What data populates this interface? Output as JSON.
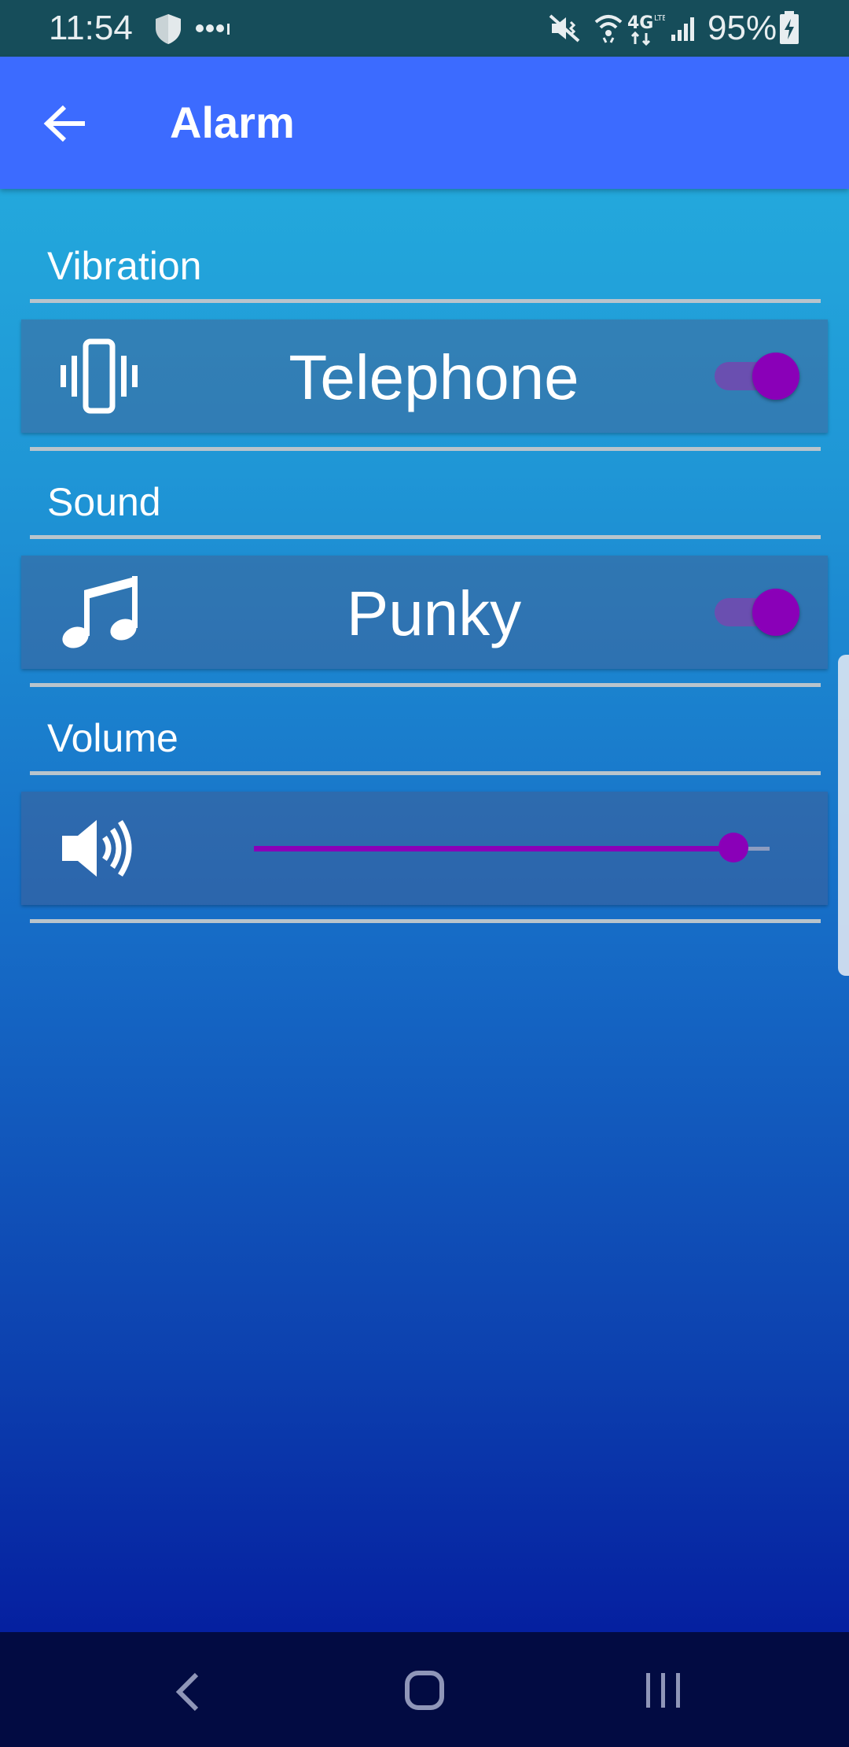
{
  "status_bar": {
    "time": "11:54",
    "battery": "95%",
    "icons": [
      "shield-icon",
      "more-dots-icon",
      "mute-vibrate-icon",
      "wifi-icon",
      "4g-lte-icon",
      "signal-icon",
      "battery-charging-icon"
    ]
  },
  "app_bar": {
    "title": "Alarm",
    "back_icon": "arrow-back-icon",
    "color": "#3c6bff"
  },
  "vibration": {
    "section_label": "Vibration",
    "item_label": "Telephone",
    "icon": "vibrate-icon",
    "enabled": true
  },
  "sound": {
    "section_label": "Sound",
    "item_label": "Punky",
    "icon": "music-note-icon",
    "enabled": true
  },
  "volume": {
    "section_label": "Volume",
    "icon": "speaker-volume-icon",
    "level": 0.93
  },
  "nav_bar": {
    "icons": [
      "nav-back-icon",
      "nav-home-icon",
      "nav-recents-icon"
    ]
  },
  "colors": {
    "accent": "#8a00b8",
    "status_bar": "#164d5a",
    "nav_bar": "#020b42"
  }
}
